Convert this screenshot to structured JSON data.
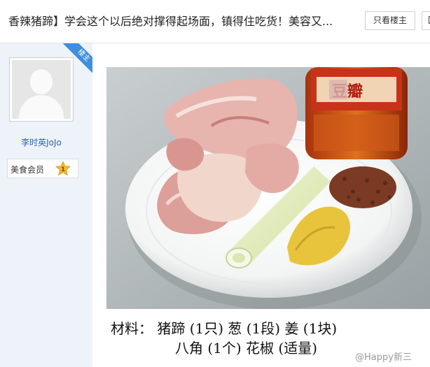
{
  "thread": {
    "title": "香辣猪蹄】学会这个以后绝对撑得起场面，镇得住吃货！美容又...",
    "only_op_label": "只看楼主",
    "reply_label": "回"
  },
  "author": {
    "badge": "楼主",
    "name": "李时英JoJo",
    "member_label": "美食会员",
    "level": "1"
  },
  "post": {
    "jar_label": "豆瓣",
    "caption_line1": "材料： 猪蹄 (1只) 葱 (1段) 姜 (1块)",
    "caption_line2": "八角 (1个) 花椒 (适量)",
    "watermark": "@Happy新三"
  },
  "icons": {
    "avatar": "default-user-avatar",
    "member_star": "star-icon"
  },
  "colors": {
    "username": "#2d64b3",
    "badge": "#3f8ee0",
    "sidebar_bg": "#eef3f9",
    "star": "#f2b82e"
  }
}
